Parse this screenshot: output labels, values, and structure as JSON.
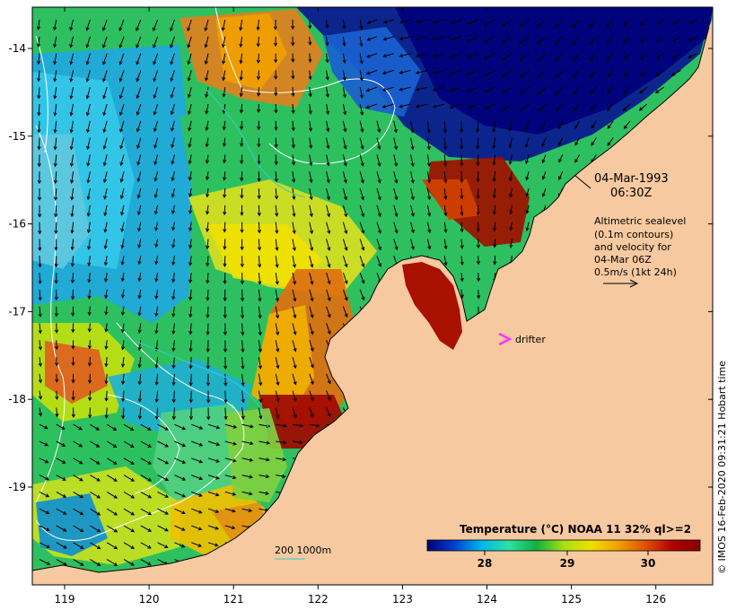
{
  "map": {
    "date": "04-Mar-1993",
    "time": "06:30Z",
    "info_lines": [
      "Altimetric sealevel",
      "(0.1m contours)",
      "and velocity for",
      "04-Mar 06Z",
      "0.5m/s (1kt 24h)"
    ],
    "drifter_label": "drifter",
    "scale_label": "200  1000m",
    "credit": "© IMOS 16-Feb-2020 09:31:21 Hobart time",
    "x_ticks": [
      "119",
      "120",
      "121",
      "122",
      "123",
      "124",
      "125",
      "126"
    ],
    "y_ticks": [
      "-14",
      "-15",
      "-16",
      "-17",
      "-18",
      "-19"
    ],
    "colorbar": {
      "title": "Temperature (°C) NOAA 11 32% ql>=2",
      "ticks": [
        "28",
        "29",
        "30"
      ],
      "colors": [
        "#00007a",
        "#0040d0",
        "#00b8e8",
        "#2ee0a0",
        "#10b040",
        "#a8e010",
        "#f0e000",
        "#f0a000",
        "#e05000",
        "#b00000",
        "#880000"
      ]
    },
    "colors": {
      "land": "#f7c9a0",
      "drifter": "#ff33ff",
      "contour": "#ffffff",
      "isobath": "#33cccc",
      "arrow": "#000000"
    }
  }
}
